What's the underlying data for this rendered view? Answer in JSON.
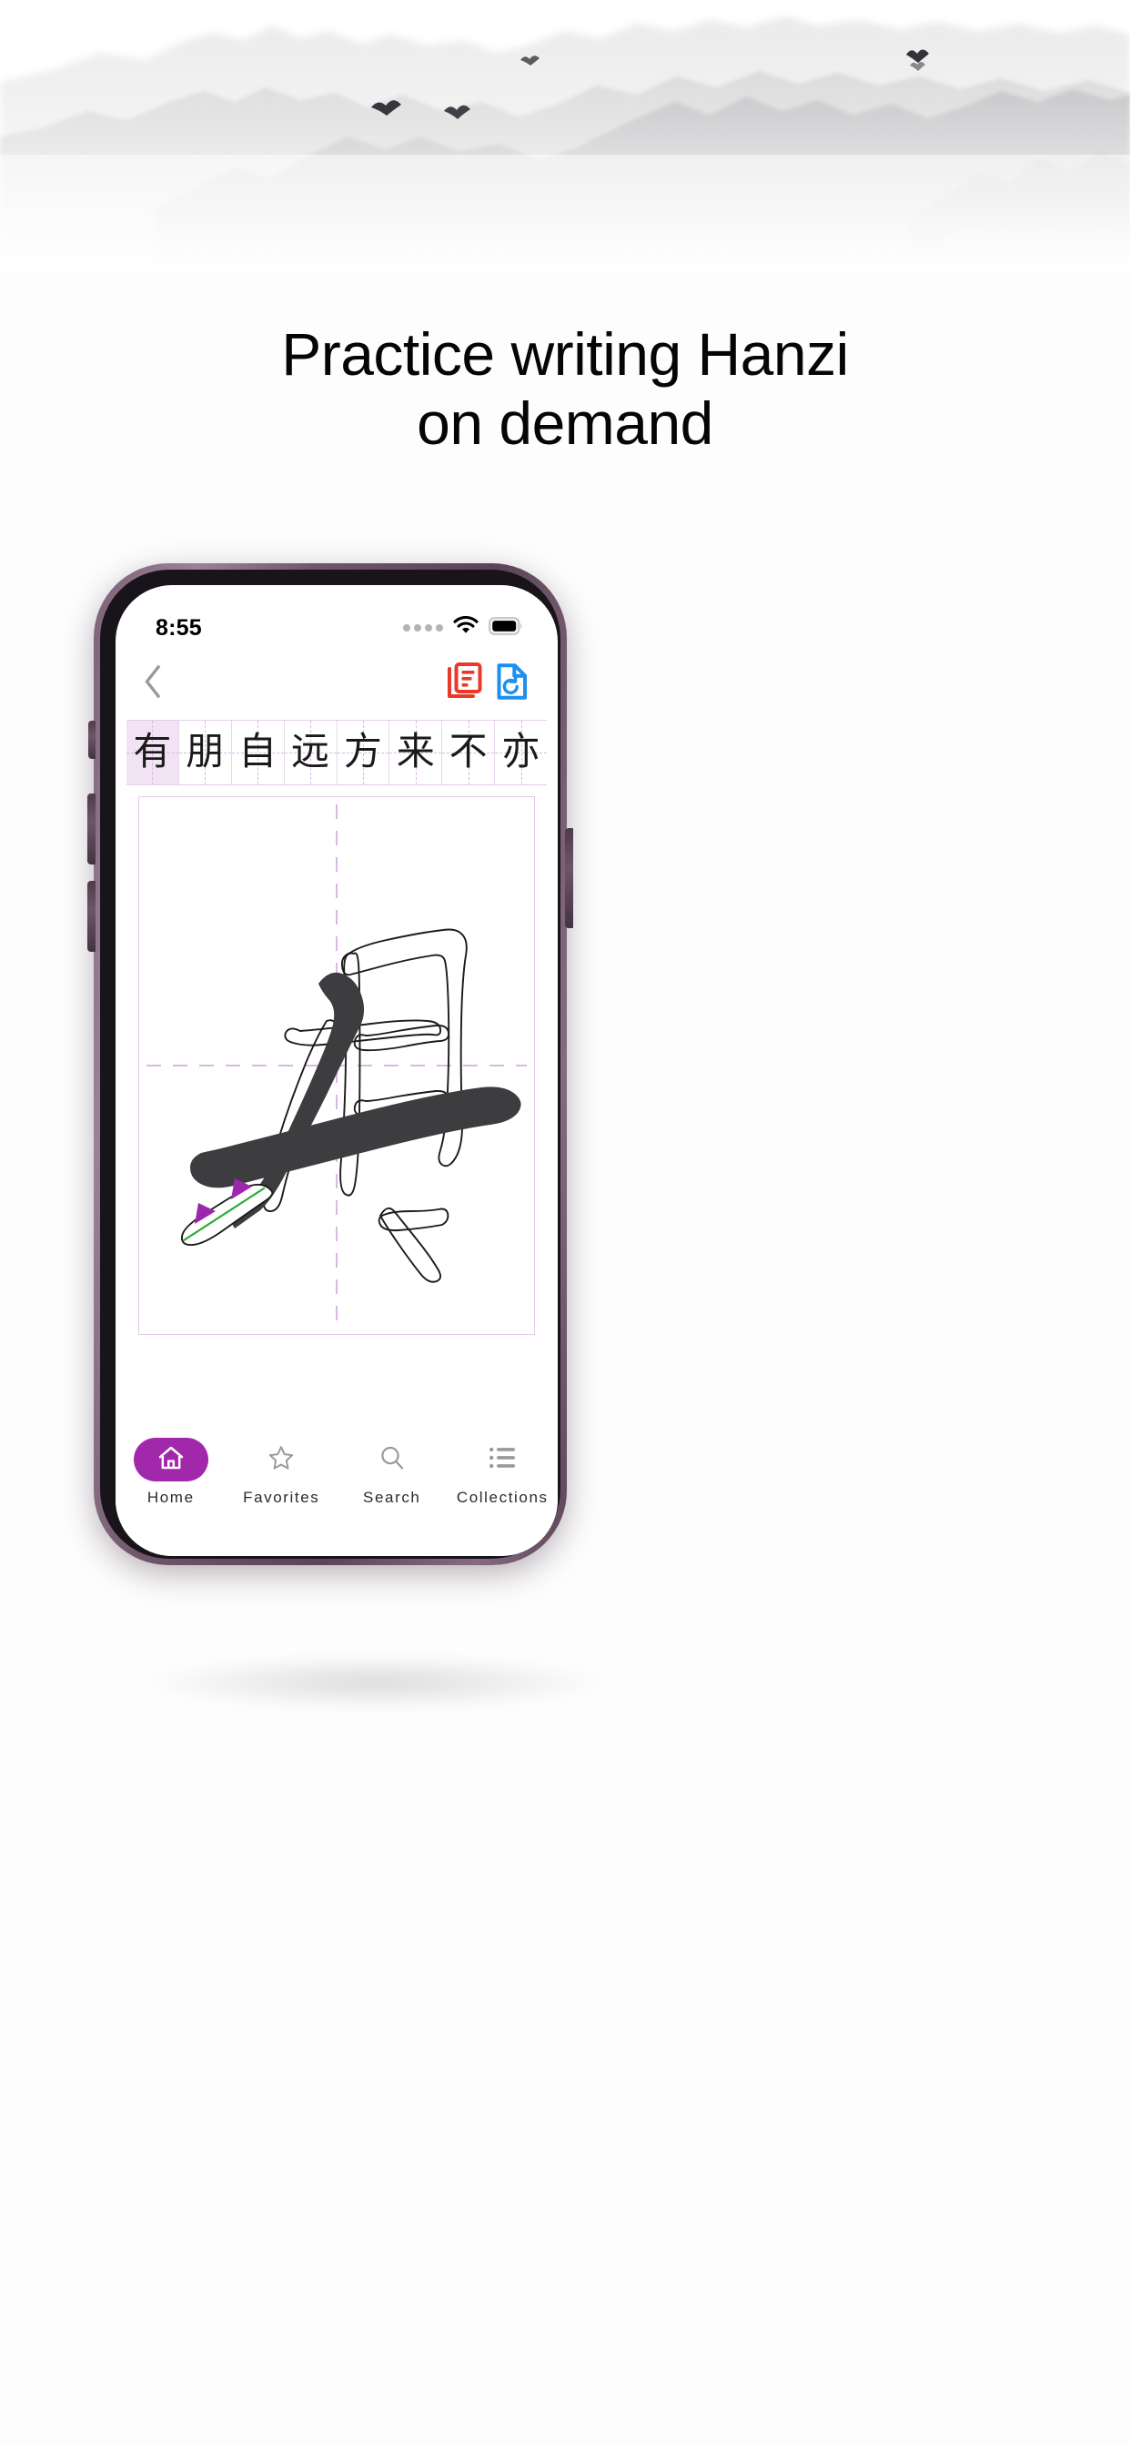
{
  "page": {
    "background_color": "#fdfdfd",
    "accent_color": "#a228ab"
  },
  "backdrop": {
    "name": "ink-wash-mountain-landscape",
    "description": "Chinese shui-mo ink wash mountains with mist and flying birds",
    "bird_count": 5,
    "ink_color": "#c9c9cb"
  },
  "headline": {
    "line1": "Practice writing Hanzi",
    "line2": "on demand",
    "color": "#050505"
  },
  "phone": {
    "frame_color": "#6e5668",
    "bezel_color": "#18141a"
  },
  "status_bar": {
    "time": "8:55",
    "cellular_dots": 4,
    "wifi_icon": "wifi-icon",
    "battery_icon": "battery-full-icon",
    "battery_level": "100"
  },
  "app_nav": {
    "back_icon": "chevron-left-icon",
    "copy_icon": "document-copy-icon",
    "copy_icon_color": "#e8392b",
    "reset_icon": "document-restore-icon",
    "reset_icon_color": "#1d8ff0"
  },
  "character_strip": {
    "active_index": 0,
    "active_bg": "#f1e2f4",
    "grid_line_color": "#dbb7e4",
    "characters": [
      "有",
      "朋",
      "自",
      "远",
      "方",
      "来",
      "不",
      "亦"
    ]
  },
  "canvas": {
    "target_character": "有",
    "guide_line_color": "#dbb7e4",
    "border_color": "#e2c9e8",
    "ink_color": "#3d3d40",
    "outline_color": "#1b1b1b",
    "stroke_path_color": "#2cab33",
    "direction_arrow_color": "#9b27ad",
    "strokes_completed": 2,
    "strokes_total": 6
  },
  "tab_bar": {
    "active_index": 0,
    "active_pill_color": "#a228ab",
    "items": [
      {
        "label": "Home",
        "icon": "home-icon"
      },
      {
        "label": "Favorites",
        "icon": "star-icon"
      },
      {
        "label": "Search",
        "icon": "search-icon"
      },
      {
        "label": "Collections",
        "icon": "list-icon"
      }
    ]
  }
}
